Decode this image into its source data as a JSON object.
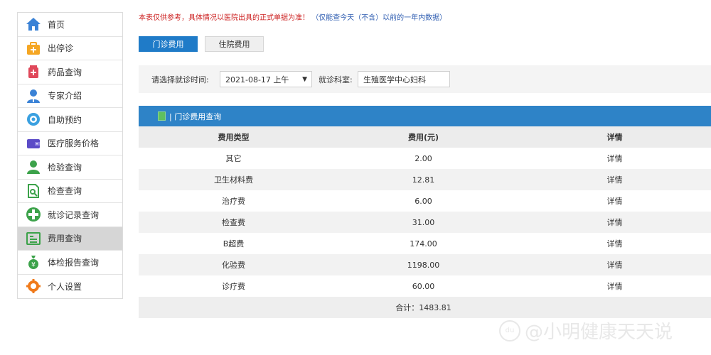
{
  "sidebar": {
    "items": [
      {
        "label": "首页",
        "icon": "home-icon",
        "color": "#3a82d6"
      },
      {
        "label": "出停诊",
        "icon": "medical-kit-icon",
        "color": "#f5a623"
      },
      {
        "label": "药品查询",
        "icon": "medicine-icon",
        "color": "#e0485a"
      },
      {
        "label": "专家介绍",
        "icon": "doctor-icon",
        "color": "#3a82d6"
      },
      {
        "label": "自助预约",
        "icon": "calendar-icon",
        "color": "#3aa0e0"
      },
      {
        "label": "医疗服务价格",
        "icon": "wallet-icon",
        "color": "#5b4bc7"
      },
      {
        "label": "检验查询",
        "icon": "person-icon",
        "color": "#3ca24a"
      },
      {
        "label": "检查查询",
        "icon": "document-search-icon",
        "color": "#3ca24a"
      },
      {
        "label": "就诊记录查询",
        "icon": "cross-icon",
        "color": "#3ca24a"
      },
      {
        "label": "费用查询",
        "icon": "bill-icon",
        "color": "#3ca24a",
        "active": true
      },
      {
        "label": "体检报告查询",
        "icon": "money-bag-icon",
        "color": "#3ca24a"
      },
      {
        "label": "个人设置",
        "icon": "gear-icon",
        "color": "#f07a1a"
      }
    ]
  },
  "notice": {
    "red": "本表仅供参考，具体情况以医院出具的正式单据为准！",
    "blue": "（仅能查今天（不含）以前的一年内数据）"
  },
  "tabs": {
    "outpatient": "门诊费用",
    "inpatient": "住院费用"
  },
  "filter": {
    "time_label": "请选择就诊时间:",
    "time_value": "2021-08-17 上午",
    "dept_label": "就诊科室:",
    "dept_value": "生殖医学中心妇科"
  },
  "table": {
    "title": "| 门诊费用查询",
    "headers": [
      "费用类型",
      "费用(元)",
      "详情"
    ],
    "rows": [
      {
        "type": "其它",
        "amount": "2.00",
        "detail": "详情"
      },
      {
        "type": "卫生材料费",
        "amount": "12.81",
        "detail": "详情"
      },
      {
        "type": "治疗费",
        "amount": "6.00",
        "detail": "详情"
      },
      {
        "type": "检查费",
        "amount": "31.00",
        "detail": "详情"
      },
      {
        "type": "B超费",
        "amount": "174.00",
        "detail": "详情"
      },
      {
        "type": "化验费",
        "amount": "1198.00",
        "detail": "详情"
      },
      {
        "type": "诊疗费",
        "amount": "60.00",
        "detail": "详情"
      }
    ],
    "total": "合计：1483.81"
  },
  "watermark": {
    "logo": "du",
    "text": "@小明健康天天说"
  },
  "colors": {
    "accent": "#1f7bc8",
    "table_header": "#2e83c7",
    "notice_red": "#cc1f1f",
    "notice_blue": "#2c5bb0"
  }
}
